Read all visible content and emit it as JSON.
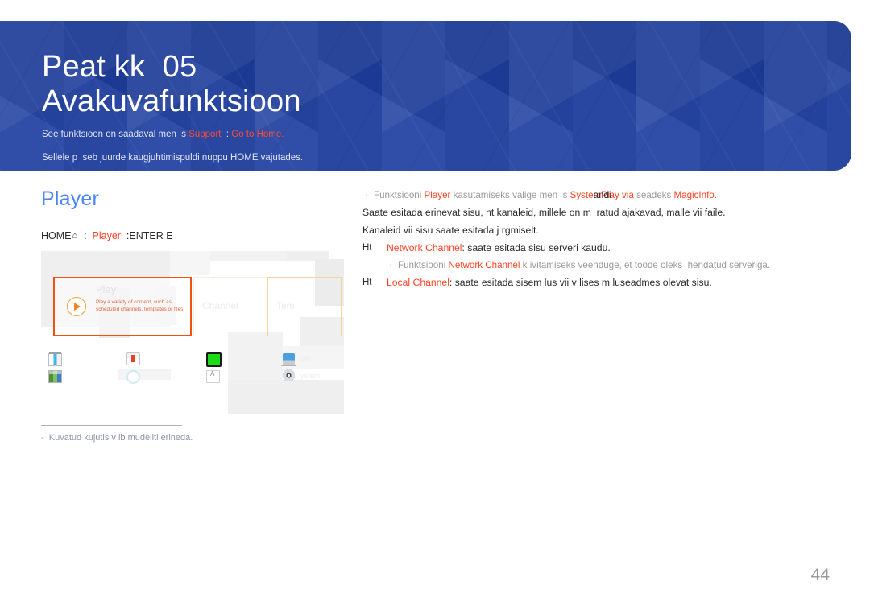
{
  "header": {
    "chapter_label": "Peat kk  05",
    "chapter_title": "Avakuvafunktsioon",
    "subtitle_line1_pre": "See funktsioon on saadaval men  s ",
    "subtitle_line1_hl1": "Support",
    "subtitle_line1_mid": "  : ",
    "subtitle_line1_hl2": "Go to Home",
    "subtitle_line1_end": ".",
    "subtitle_line2": "Sellele p  seb juurde kaugjuhtimispuldi nuppu HOME vajutades."
  },
  "section": {
    "title": "Player",
    "path_prefix": "HOME",
    "path_house_icon": "home-icon",
    "path_mid": "  :  ",
    "path_item": "Player",
    "path_suffix": "  :ENTER E"
  },
  "figure": {
    "play_card": {
      "title": "Play",
      "description": "Play a variety of content, such as\nscheduled channels, templates or files.",
      "play_icon": "play-circle-icon"
    },
    "channel_card_title": "Channel",
    "template_card_title": "Tem",
    "icons": [
      {
        "name": "clone-product-icon"
      },
      {
        "name": "id-settings-icon"
      },
      {
        "name": "video-wall-icon"
      },
      {
        "name": "network-status-icon"
      },
      {
        "name": "on-off-timer-icon"
      },
      {
        "name": "reset-icon"
      },
      {
        "name": "security-icon"
      },
      {
        "name": "system-icon"
      }
    ],
    "labels": {
      "network": "ork",
      "system": "ystem"
    },
    "caption": "-  Kuvatud kujutis v ib mudeliti erineda."
  },
  "body": {
    "note1_pre": "Funktsiooni ",
    "note1_hl1": "Player",
    "note1_mid1": " kasutamiseks valige men  s ",
    "note1_hl2": "System",
    "note1_overlap": "andi ",
    "note1_hl3": "Play via",
    "note1_mid2": " seadeks ",
    "note1_hl4": "MagicInfo",
    "note1_end": ".",
    "line1": "Saate esitada erinevat sisu, nt kanaleid, millele on m  ratud ajakavad, malle vii faile.",
    "line2": "Kanaleid vii sisu saate esitada j rgmiselt.",
    "bullet1_marker": "Ht",
    "bullet1_hl": "Network Channel",
    "bullet1_text": ": saate esitada sisu serveri kaudu.",
    "note2_pre": "Funktsiooni ",
    "note2_hl": "Network Channel",
    "note2_text": " k ivitamiseks veenduge, et toode oleks  hendatud serveriga.",
    "bullet2_marker": "Ht",
    "bullet2_hl": "Local Channel",
    "bullet2_text": ": saate esitada sisem lus vii v lises m luseadmes olevat sisu."
  },
  "page_number": "44",
  "colors": {
    "banner_blue": "#1e3fa0",
    "heading_blue": "#4a86f7",
    "accent_red": "#ff4223",
    "highlight_orange": "#f4500f"
  }
}
